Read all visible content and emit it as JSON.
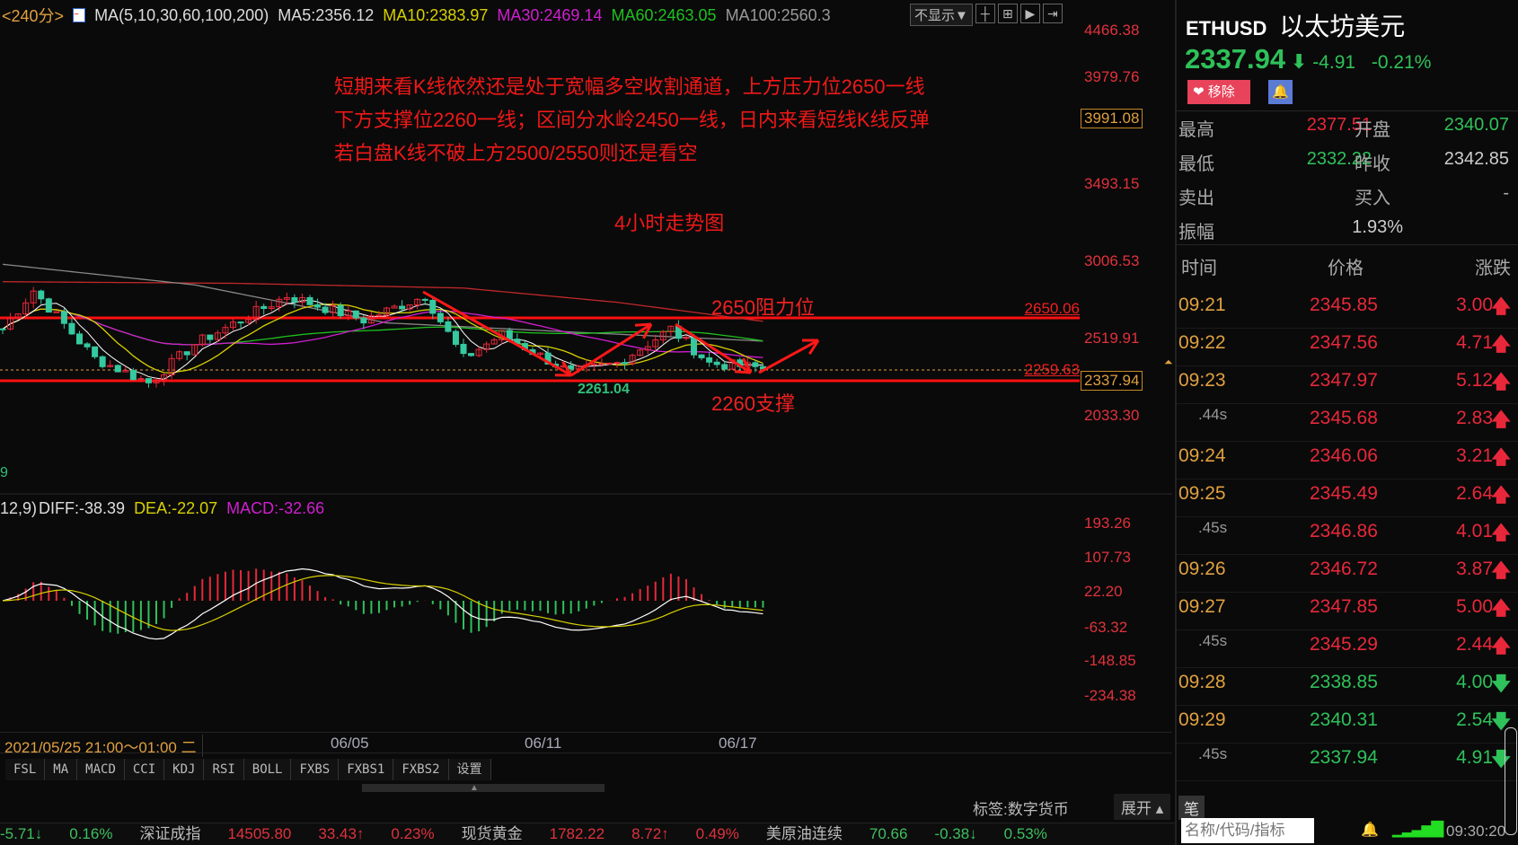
{
  "header": {
    "period": "<240分>",
    "ma_label": "MA(5,10,30,60,100,200)",
    "ma5": "MA5:2356.12",
    "ma10": "MA10:2383.97",
    "ma30": "MA30:2469.14",
    "ma60": "MA60:2463.05",
    "ma100": "MA100:2560.3",
    "display_select": "不显示▼"
  },
  "price_axis": [
    "4466.38",
    "3979.76",
    "3493.15",
    "3006.53",
    "2519.91",
    "2033.30"
  ],
  "crosshair_value": "3991.08",
  "current_price_tag": "2337.94",
  "lines": {
    "resistance_value": "2650.06",
    "dashed_value": "2259.63",
    "low_label": "2261.04",
    "resistance_text": "2650阻力位",
    "support_text": "2260支撑"
  },
  "annotations": [
    "短期来看K线依然还是处于宽幅多空收割通道，上方压力位2650一线",
    "下方支撑位2260一线；区间分水岭2450一线，日内来看短线K线反弹",
    " 若白盘K线不破上方2500/2550则还是看空"
  ],
  "chart_title": "4小时走势图",
  "volume_stub": "9",
  "macd": {
    "params": "12,9)",
    "diff": "DIFF:-38.39",
    "dea": "DEA:-22.07",
    "macd": "MACD:-32.66",
    "axis": [
      "193.26",
      "107.73",
      "22.20",
      "-63.32",
      "-148.85",
      "-234.38"
    ]
  },
  "dates": {
    "cursor": "2021/05/25 21:00～01:00 二",
    "ticks": [
      "06/05",
      "06/11",
      "06/17"
    ]
  },
  "indicator_tabs": [
    "FSL",
    "MA",
    "MACD",
    "CCI",
    "KDJ",
    "RSI",
    "BOLL",
    "FXBS",
    "FXBS1",
    "FXBS2",
    "设置"
  ],
  "tag_label": "标签:数字货币",
  "expand_label": "展开 ▴",
  "pen_tab": "笔",
  "chart_data": {
    "type": "candlestick",
    "keypoints": [
      [
        0,
        2582
      ],
      [
        4,
        2825
      ],
      [
        12,
        2395
      ],
      [
        19,
        2242
      ],
      [
        25,
        2486
      ],
      [
        37,
        2791
      ],
      [
        47,
        2638
      ],
      [
        55,
        2791
      ],
      [
        60,
        2395
      ],
      [
        65,
        2548
      ],
      [
        74,
        2304
      ],
      [
        80,
        2366
      ],
      [
        87,
        2582
      ],
      [
        92,
        2366
      ],
      [
        99,
        2333
      ]
    ],
    "ma100": [
      [
        0,
        2990
      ],
      [
        25,
        2860
      ],
      [
        50,
        2620
      ],
      [
        75,
        2560
      ],
      [
        99,
        2505
      ]
    ],
    "ma200": [
      [
        0,
        2880
      ],
      [
        30,
        2870
      ],
      [
        60,
        2840
      ],
      [
        80,
        2750
      ],
      [
        99,
        2630
      ]
    ],
    "ylim": [
      2033.3,
      4466.38
    ]
  },
  "quote": {
    "symbol": "ETHUSD",
    "name": "以太坊美元",
    "price": "2337.94",
    "change": "-4.91",
    "pct": "-0.21%",
    "remove": "移除",
    "stats": [
      [
        "最高",
        "2377.51",
        "开盘",
        "2340.07"
      ],
      [
        "最低",
        "2332.22",
        "昨收",
        "2342.85"
      ],
      [
        "卖出",
        "-",
        "买入",
        "-"
      ],
      [
        "振幅",
        "1.93%",
        "",
        ""
      ]
    ],
    "cols": [
      "时间",
      "价格",
      "涨跌"
    ],
    "ticks": [
      [
        "09:21",
        "2345.85",
        "3.00",
        "up"
      ],
      [
        "09:22",
        "2347.56",
        "4.71",
        "up"
      ],
      [
        "09:23",
        "2347.97",
        "5.12",
        "up"
      ],
      [
        ".44s",
        "2345.68",
        "2.83",
        "up"
      ],
      [
        "09:24",
        "2346.06",
        "3.21",
        "up"
      ],
      [
        "09:25",
        "2345.49",
        "2.64",
        "up"
      ],
      [
        ".45s",
        "2346.86",
        "4.01",
        "up"
      ],
      [
        "09:26",
        "2346.72",
        "3.87",
        "up"
      ],
      [
        "09:27",
        "2347.85",
        "5.00",
        "up"
      ],
      [
        ".45s",
        "2345.29",
        "2.44",
        "up"
      ],
      [
        "09:28",
        "2338.85",
        "4.00",
        "down"
      ],
      [
        "09:29",
        "2340.31",
        "2.54",
        "down"
      ],
      [
        ".45s",
        "2337.94",
        "4.91",
        "down"
      ]
    ]
  },
  "ticker": [
    [
      "-5.71↓",
      "#3fbf5f"
    ],
    [
      "0.16%",
      "#3fbf5f"
    ],
    [
      "深证成指",
      "#bbb"
    ],
    [
      "14505.80",
      "#e0323c"
    ],
    [
      "33.43↑",
      "#e0323c"
    ],
    [
      "0.23%",
      "#e0323c"
    ],
    [
      "现货黄金",
      "#bbb"
    ],
    [
      "1782.22",
      "#e0323c"
    ],
    [
      "8.72↑",
      "#e0323c"
    ],
    [
      "0.49%",
      "#e0323c"
    ],
    [
      "美原油连续",
      "#bbb"
    ],
    [
      "70.66",
      "#3fbf5f"
    ],
    [
      "-0.38↓",
      "#3fbf5f"
    ],
    [
      "0.53%",
      "#3fbf5f"
    ]
  ],
  "search_placeholder": "名称/代码/指标",
  "clock": "09:30:20",
  "colors": {
    "up": "#e8283a",
    "down": "#2fc15a",
    "ma5": "#ffffff",
    "ma10": "#d7d000",
    "ma30": "#d01ed0",
    "ma60": "#1fc01f",
    "ma100": "#888888",
    "ma200": "#c0282a"
  }
}
